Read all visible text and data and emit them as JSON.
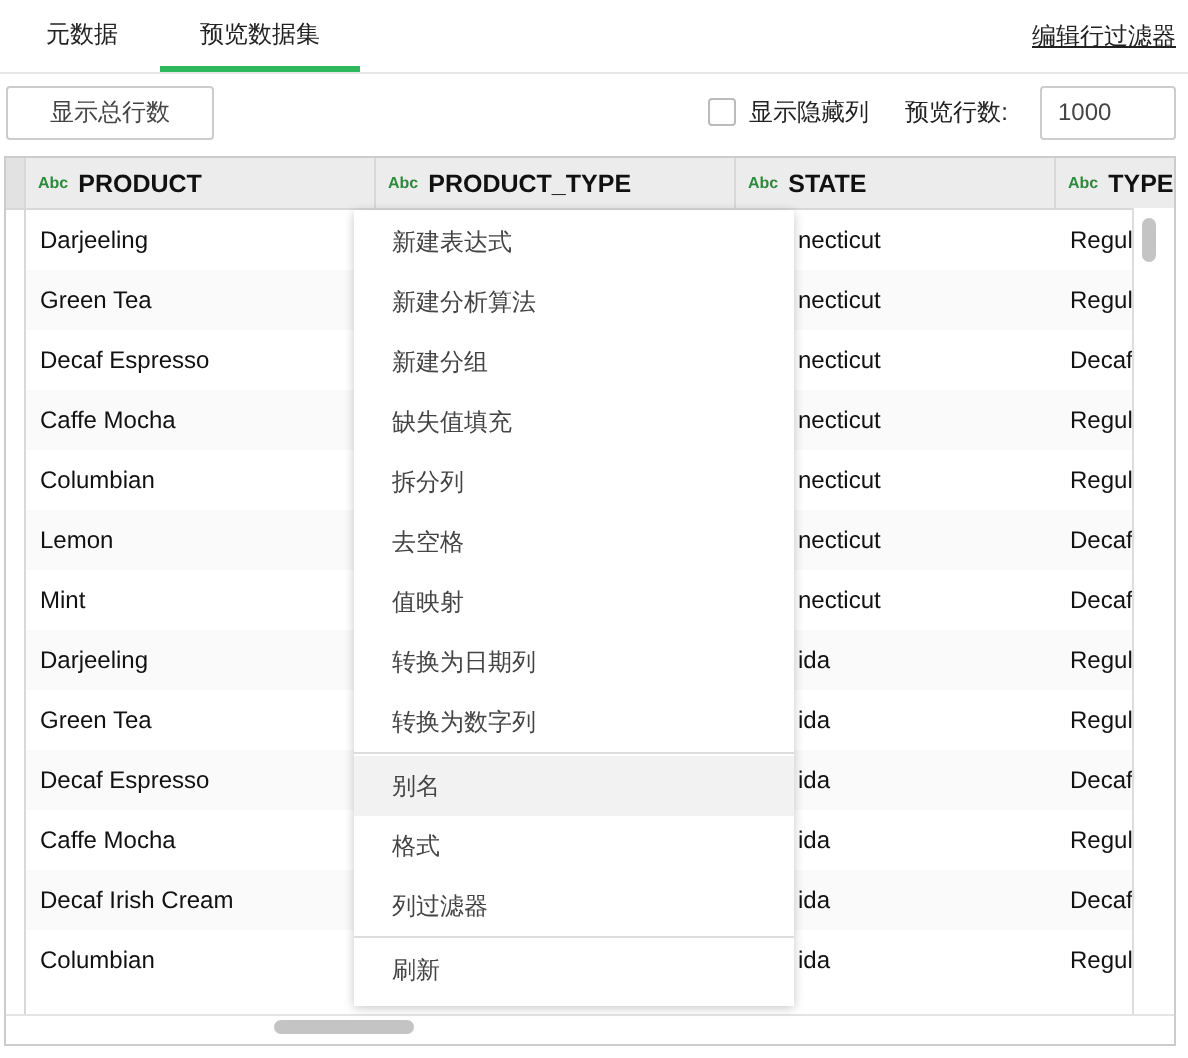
{
  "tabs": [
    {
      "label": "元数据",
      "selected": false
    },
    {
      "label": "预览数据集",
      "selected": true
    }
  ],
  "filter_link": "编辑行过滤器",
  "toolbar": {
    "total_button": "显示总行数",
    "show_hidden": {
      "label": "显示隐藏列",
      "checked": false
    },
    "preview_rows_label": "预览行数:",
    "preview_rows_value": "1000"
  },
  "table": {
    "columns": [
      {
        "type_label": "Abc",
        "name": "PRODUCT"
      },
      {
        "type_label": "Abc",
        "name": "PRODUCT_TYPE"
      },
      {
        "type_label": "Abc",
        "name": "STATE"
      },
      {
        "type_label": "Abc",
        "name": "TYPE"
      }
    ],
    "rows": [
      {
        "product": "Darjeeling",
        "state": "necticut",
        "type": "Regul"
      },
      {
        "product": "Green Tea",
        "state": "necticut",
        "type": "Regul"
      },
      {
        "product": "Decaf Espresso",
        "state": "necticut",
        "type": "Decaf"
      },
      {
        "product": "Caffe Mocha",
        "state": "necticut",
        "type": "Regul"
      },
      {
        "product": "Columbian",
        "state": "necticut",
        "type": "Regul"
      },
      {
        "product": "Lemon",
        "state": "necticut",
        "type": "Decaf"
      },
      {
        "product": "Mint",
        "state": "necticut",
        "type": "Decaf"
      },
      {
        "product": "Darjeeling",
        "state": "ida",
        "type": "Regul"
      },
      {
        "product": "Green Tea",
        "state": "ida",
        "type": "Regul"
      },
      {
        "product": "Decaf Espresso",
        "state": "ida",
        "type": "Decaf"
      },
      {
        "product": "Caffe Mocha",
        "state": "ida",
        "type": "Regul"
      },
      {
        "product": "Decaf Irish Cream",
        "state": "ida",
        "type": "Decaf"
      },
      {
        "product": "Columbian",
        "state": "ida",
        "type": "Regul"
      }
    ]
  },
  "context_menu": [
    {
      "label": "新建表达式",
      "highlighted": false,
      "separator_after": false
    },
    {
      "label": "新建分析算法",
      "highlighted": false,
      "separator_after": false
    },
    {
      "label": "新建分组",
      "highlighted": false,
      "separator_after": false
    },
    {
      "label": "缺失值填充",
      "highlighted": false,
      "separator_after": false
    },
    {
      "label": "拆分列",
      "highlighted": false,
      "separator_after": false
    },
    {
      "label": "去空格",
      "highlighted": false,
      "separator_after": false
    },
    {
      "label": "值映射",
      "highlighted": false,
      "separator_after": false
    },
    {
      "label": "转换为日期列",
      "highlighted": false,
      "separator_after": false
    },
    {
      "label": "转换为数字列",
      "highlighted": false,
      "separator_after": true
    },
    {
      "label": "别名",
      "highlighted": true,
      "separator_after": false
    },
    {
      "label": "格式",
      "highlighted": false,
      "separator_after": false
    },
    {
      "label": "列过滤器",
      "highlighted": false,
      "separator_after": true
    },
    {
      "label": "刷新",
      "highlighted": false,
      "separator_after": false
    }
  ]
}
